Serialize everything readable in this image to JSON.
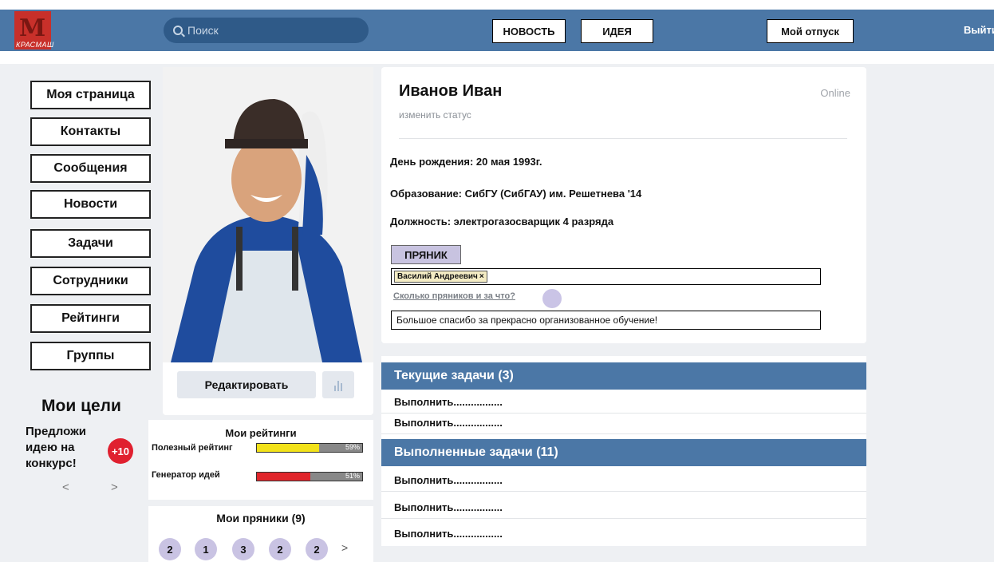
{
  "header": {
    "logo_text": "КРАСМАШ",
    "search_placeholder": "Поиск",
    "news_button": "НОВОСТЬ",
    "idea_button": "ИДЕЯ",
    "vacation_button": "Мой отпуск",
    "logout": "Выйти"
  },
  "menu": {
    "items": [
      {
        "label": "Моя страница"
      },
      {
        "label": "Контакты"
      },
      {
        "label": "Сообщения"
      },
      {
        "label": "Новости"
      },
      {
        "label": "Задачи"
      },
      {
        "label": "Сотрудники"
      },
      {
        "label": "Рейтинги"
      },
      {
        "label": "Группы"
      }
    ]
  },
  "goals": {
    "title": "Мои цели",
    "text": "Предложи идею на конкурс!",
    "badge": "+10",
    "prev": "<",
    "next": ">"
  },
  "photo_card": {
    "edit_button": "Редактировать"
  },
  "ratings": {
    "title": "Мои рейтинги",
    "items": [
      {
        "label": "Полезный рейтинг",
        "percent_text": "59%",
        "value": 0.59,
        "color": "#f2e21a"
      },
      {
        "label": "Генератор идей",
        "percent_text": "51%",
        "value": 0.51,
        "color": "#e0252b"
      }
    ]
  },
  "gingers": {
    "title": "Мои пряники (9)",
    "values": [
      "2",
      "1",
      "3",
      "2",
      "2"
    ],
    "next": ">"
  },
  "profile": {
    "name": "Иванов Иван",
    "status_link": "изменить статус",
    "online": "Online",
    "birthday": "День рождения: 20 мая 1993г.",
    "education": "Образование: СибГУ (СибГАУ) им. Решетнева '14",
    "position": "Должность:  электрогазосварщик 4 разряда",
    "ginger_button": "ПРЯНИК",
    "recipient_tag": "Василий Андреевич",
    "recipient_remove": "×",
    "how_link": "Сколько пряников и за что?",
    "comment": "Большое спасибо за прекрасно организованное обучение!"
  },
  "tasks": {
    "current_title": "Текущие задачи (3)",
    "current": [
      "Выполнить.................",
      "Выполнить................."
    ],
    "done_title": "Выполненные задачи (11)",
    "done": [
      "Выполнить.................",
      "Выполнить.................",
      "Выполнить................."
    ]
  },
  "colors": {
    "header_blue": "#4b77a6",
    "ginger_purple": "#c9c3e3",
    "badge_red": "#e0202f"
  }
}
